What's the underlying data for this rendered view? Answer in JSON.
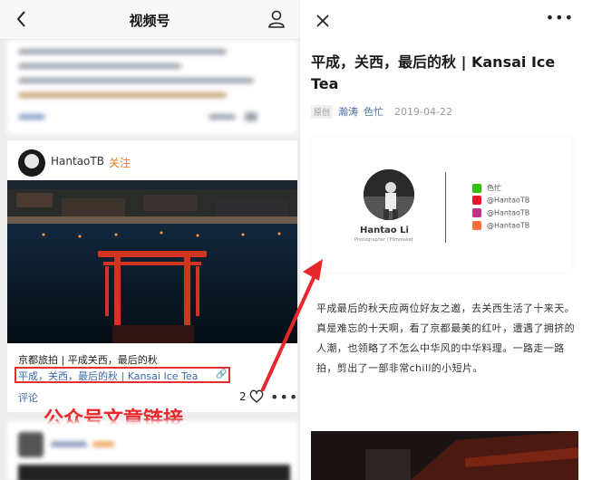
{
  "left": {
    "nav_title": "视频号",
    "post": {
      "author": "HantaoTB",
      "follow": "关注",
      "caption": "京都旅拍 | 平成关西，最后的秋",
      "link_text": "平成，关西，最后的秋 | Kansai Ice Tea",
      "comment_label": "评论",
      "like_count": "2"
    },
    "annotation": "公众号文章链接"
  },
  "right": {
    "article_title": "平成，关西，最后的秋 | Kansai Ice Tea",
    "original_tag": "原创",
    "authors": [
      "瀚涛",
      "色忙"
    ],
    "date": "2019-04-22",
    "card": {
      "name": "Hantao  Li",
      "subtitle": "Photographer | Filmmaker",
      "social": [
        {
          "icon": "wechat-icon",
          "label": "色忙",
          "color": "#2dc100"
        },
        {
          "icon": "weibo-icon",
          "label": "@HantaoTB",
          "color": "#e6162d"
        },
        {
          "icon": "instagram-icon",
          "label": "@HantaoTB",
          "color": "#c13584"
        },
        {
          "icon": "rednote-icon",
          "label": "@HantaoTB",
          "color": "#ff6d3a"
        }
      ]
    },
    "body": "平成最后的秋天应两位好友之邀，去关西生活了十来天。真是难忘的十天啊，看了京都最美的红叶，遭遇了拥挤的人潮，也领略了不怎么中华风的中华料理。一路走一路拍，剪出了一部非常chill的小短片。"
  },
  "colors": {
    "annotation": "#e8272d",
    "link": "#3a6aa7",
    "follow": "#e07b1f"
  }
}
